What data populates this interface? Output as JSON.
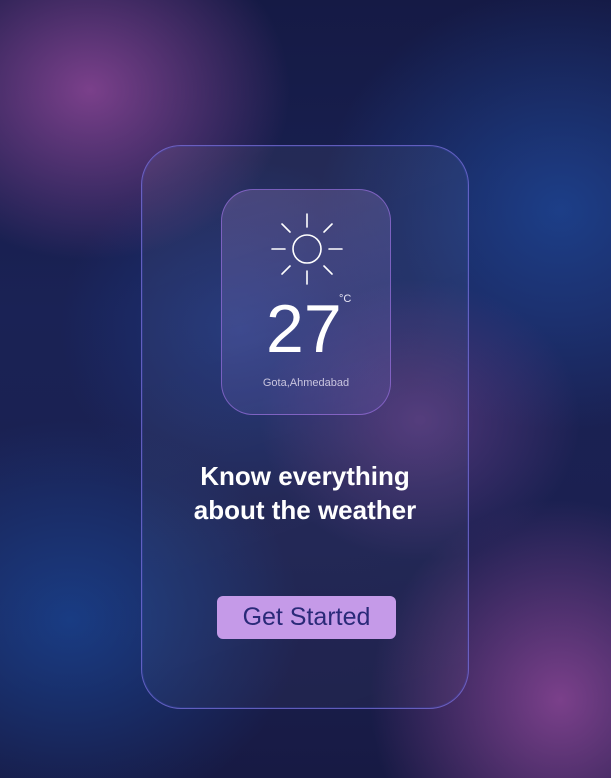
{
  "weather_card": {
    "temperature": "27",
    "unit": "°C",
    "location": "Gota,Ahmedabad",
    "icon": "sun-icon"
  },
  "onboarding": {
    "headline_line1": "Know everything",
    "headline_line2": "about the weather",
    "cta_label": "Get Started"
  },
  "colors": {
    "cta_background": "#c59ae8",
    "cta_text": "#2a2a78",
    "card_border": "#7a6edc",
    "background_blue": "#1a2255",
    "background_purple": "#8c4696"
  }
}
